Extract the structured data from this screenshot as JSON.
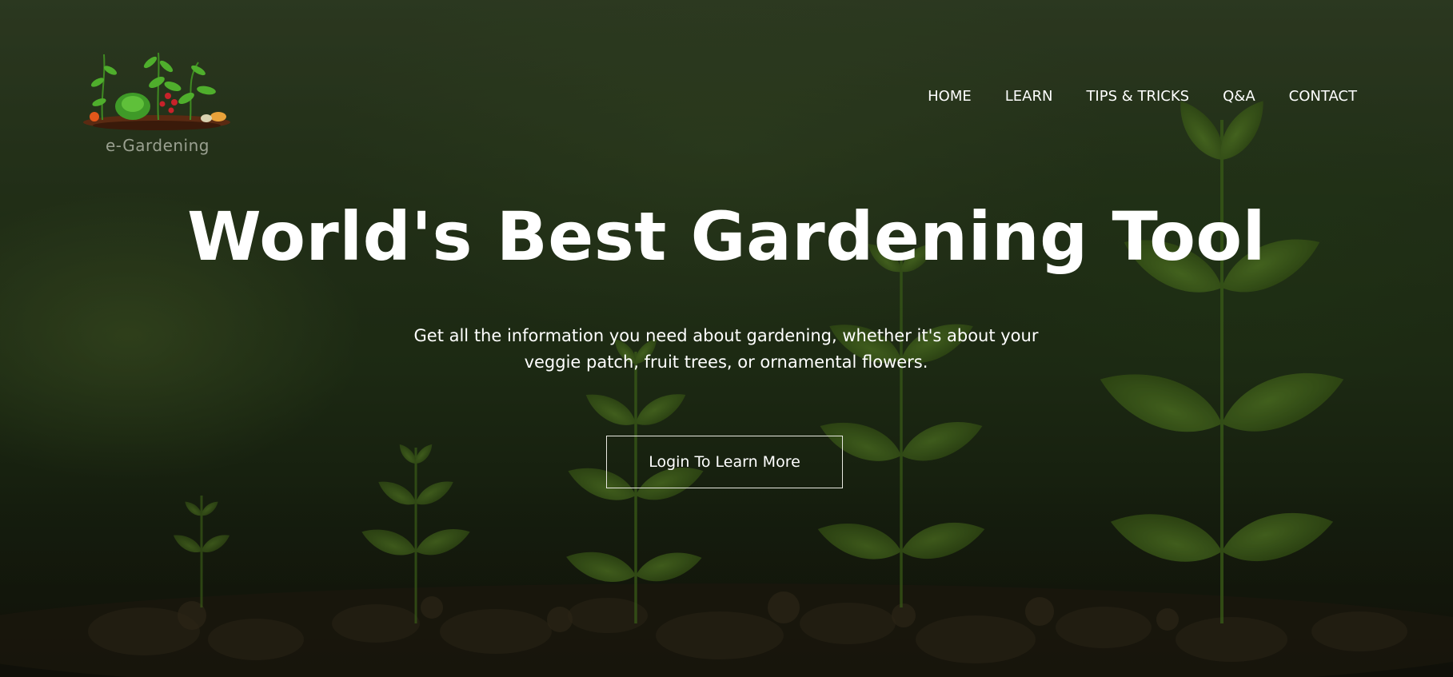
{
  "brand": {
    "name": "e-Gardening",
    "logo_icon": "garden-plants-logo-icon"
  },
  "nav": {
    "items": [
      {
        "label": "HOME"
      },
      {
        "label": "LEARN"
      },
      {
        "label": "TIPS & TRICKS"
      },
      {
        "label": "Q&A"
      },
      {
        "label": "CONTACT"
      }
    ]
  },
  "hero": {
    "title": "World's Best Gardening Tool",
    "subtitle": "Get all the information you need about gardening, whether it's about your veggie patch, fruit trees, or ornamental flowers.",
    "cta_label": "Login To Learn More",
    "background_image": "seedlings-in-soil"
  },
  "colors": {
    "text": "#ffffff",
    "logo_text": "#9aa090",
    "overlay": "#243418",
    "soil": "#2a2014",
    "leaf": "#4f7a1e"
  }
}
